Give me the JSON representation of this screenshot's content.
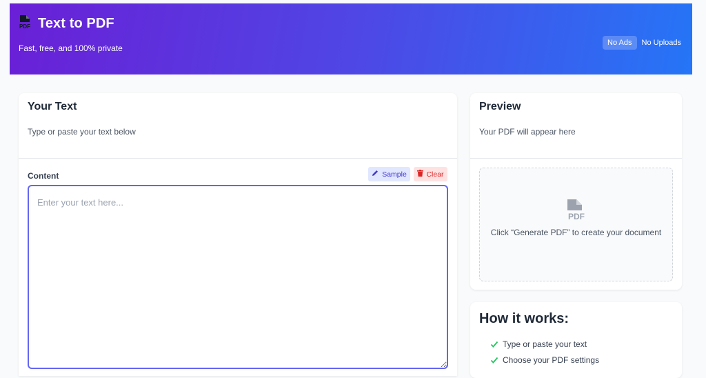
{
  "header": {
    "title": "Text to PDF",
    "subtitle": "Fast, free, and 100% private",
    "badges": [
      "No Ads",
      "No Uploads"
    ],
    "gradient_colors": [
      "#6a1fd6",
      "#2575f7"
    ]
  },
  "editor_card": {
    "title": "Your Text",
    "subtitle": "Type or paste your text below",
    "content_label": "Content",
    "sample_label": "Sample",
    "clear_label": "Clear",
    "textarea_placeholder": "Enter your text here...",
    "textarea_value": ""
  },
  "preview_card": {
    "title": "Preview",
    "subtitle": "Your PDF will appear here",
    "empty_message": "Click “Generate PDF” to create your document",
    "icon": "pdf-file-icon"
  },
  "how_it_works": {
    "title": "How it works:",
    "steps": [
      "Type or paste your text",
      "Choose your PDF settings"
    ]
  },
  "colors": {
    "accent": "#6366f1",
    "sample_bg": "#e0e7ff",
    "clear_bg": "#fee2e2",
    "check": "#22c55e"
  }
}
